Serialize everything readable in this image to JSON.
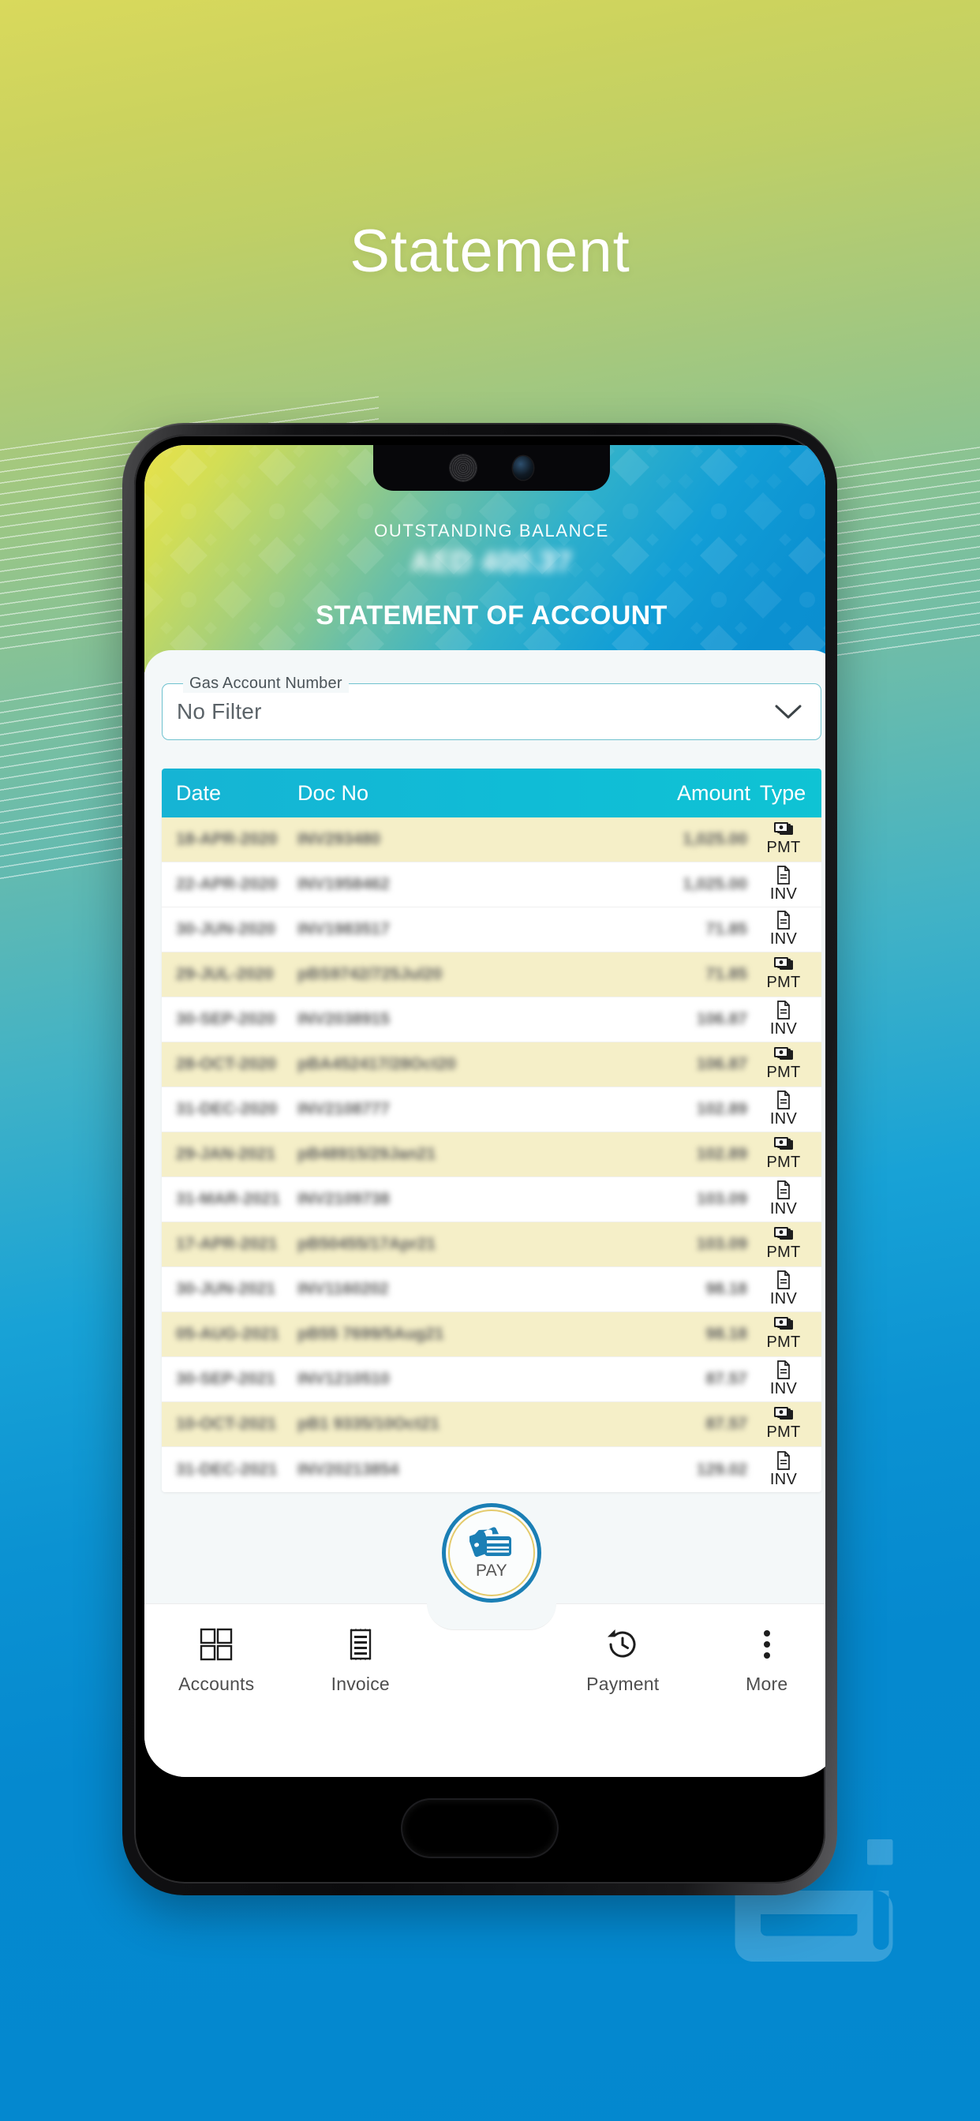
{
  "page": {
    "title": "Statement",
    "background_gradient_from": "#d9d95c",
    "background_gradient_to": "#0388cf",
    "watermark": "arabic-calligraphy-logo"
  },
  "app_header": {
    "outstanding_balance_label": "OUTSTANDING BALANCE",
    "outstanding_balance_amount": "AED 400.37",
    "screen_title": "STATEMENT OF ACCOUNT",
    "gradient_from": "#e8e24a",
    "gradient_to": "#0b8ed0"
  },
  "filter": {
    "label": "Gas Account Number",
    "value": "No Filter",
    "chevron_icon": "chevron-down-icon"
  },
  "table": {
    "header_color": "#12b8d5",
    "pmt_row_color": "#f5efc8",
    "inv_row_color": "#ffffff",
    "columns": [
      "Date",
      "Doc No",
      "Amount",
      "Type"
    ],
    "rows": [
      {
        "date": "18-APR-2020",
        "doc_no": "INV293480",
        "amount": "1,025.00",
        "type": "PMT",
        "type_icon": "banknotes-icon"
      },
      {
        "date": "22-APR-2020",
        "doc_no": "INV1958462",
        "amount": "1,025.00",
        "type": "INV",
        "type_icon": "document-icon"
      },
      {
        "date": "30-JUN-2020",
        "doc_no": "INV1983517",
        "amount": "71.85",
        "type": "INV",
        "type_icon": "document-icon"
      },
      {
        "date": "29-JUL-2020",
        "doc_no": "pBS9742/725Jul20",
        "amount": "71.85",
        "type": "PMT",
        "type_icon": "banknotes-icon"
      },
      {
        "date": "30-SEP-2020",
        "doc_no": "INV2038915",
        "amount": "106.87",
        "type": "INV",
        "type_icon": "document-icon"
      },
      {
        "date": "28-OCT-2020",
        "doc_no": "pBA452417/28Oct20",
        "amount": "106.87",
        "type": "PMT",
        "type_icon": "banknotes-icon"
      },
      {
        "date": "31-DEC-2020",
        "doc_no": "INV2108777",
        "amount": "102.89",
        "type": "INV",
        "type_icon": "document-icon"
      },
      {
        "date": "29-JAN-2021",
        "doc_no": "pB48915/29Jan21",
        "amount": "102.89",
        "type": "PMT",
        "type_icon": "banknotes-icon"
      },
      {
        "date": "31-MAR-2021",
        "doc_no": "INV2109738",
        "amount": "103.09",
        "type": "INV",
        "type_icon": "document-icon"
      },
      {
        "date": "17-APR-2021",
        "doc_no": "pB50455/17Apr21",
        "amount": "103.09",
        "type": "PMT",
        "type_icon": "banknotes-icon"
      },
      {
        "date": "30-JUN-2021",
        "doc_no": "INV1160202",
        "amount": "98.18",
        "type": "INV",
        "type_icon": "document-icon"
      },
      {
        "date": "05-AUG-2021",
        "doc_no": "pB55 7699/5Aug21",
        "amount": "98.18",
        "type": "PMT",
        "type_icon": "banknotes-icon"
      },
      {
        "date": "30-SEP-2021",
        "doc_no": "INV1210510",
        "amount": "87.57",
        "type": "INV",
        "type_icon": "document-icon"
      },
      {
        "date": "10-OCT-2021",
        "doc_no": "pB1 9335/10Oct21",
        "amount": "87.57",
        "type": "PMT",
        "type_icon": "banknotes-icon"
      },
      {
        "date": "31-DEC-2021",
        "doc_no": "INV20213854",
        "amount": "129.02",
        "type": "INV",
        "type_icon": "document-icon"
      }
    ]
  },
  "pay_fab": {
    "label": "PAY",
    "icon": "credit-cards-icon",
    "ring_color": "#1b7fb5",
    "inner_ring_color": "#e4ca6b"
  },
  "bottom_nav": {
    "items": [
      {
        "label": "Accounts",
        "icon": "grid-icon"
      },
      {
        "label": "Invoice",
        "icon": "receipt-icon"
      },
      {
        "label": "Payment",
        "icon": "history-clock-icon"
      },
      {
        "label": "More",
        "icon": "three-dots-vertical-icon"
      }
    ]
  }
}
